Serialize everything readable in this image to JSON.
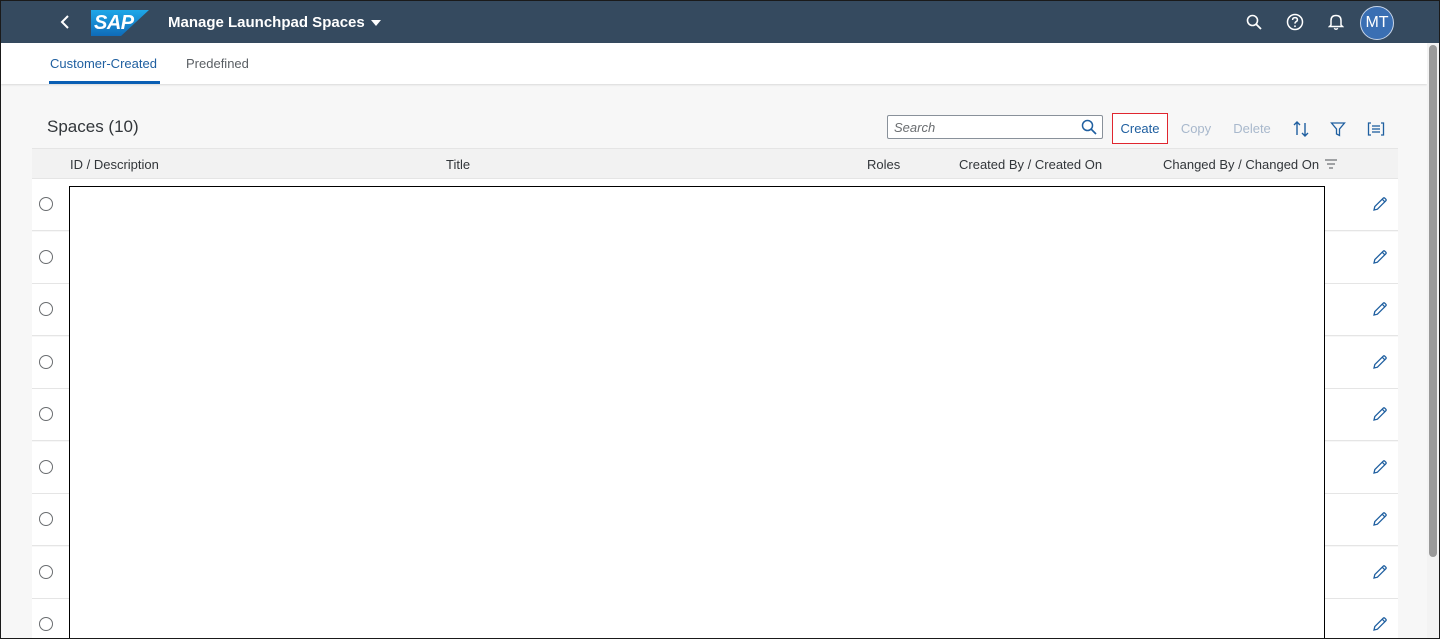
{
  "shell": {
    "app_title": "Manage Launchpad Spaces",
    "logo_text": "SAP",
    "avatar_initials": "MT",
    "colors": {
      "shell_bg": "#354a5f",
      "avatar_bg": "#3a6fb3"
    },
    "icons": [
      "back-icon",
      "search-icon",
      "help-icon",
      "bell-icon"
    ]
  },
  "tabs": [
    {
      "label": "Customer-Created",
      "active": true
    },
    {
      "label": "Predefined",
      "active": false
    }
  ],
  "toolbar": {
    "title": "Spaces (10)",
    "search_placeholder": "Search",
    "create_label": "Create",
    "copy_label": "Copy",
    "delete_label": "Delete",
    "icons": [
      "sort-icon",
      "filter-icon",
      "group-icon"
    ]
  },
  "table": {
    "columns": [
      "ID / Description",
      "Title",
      "Roles",
      "Created By / Created On",
      "Changed By / Changed On"
    ],
    "row_count_visible": 9
  }
}
